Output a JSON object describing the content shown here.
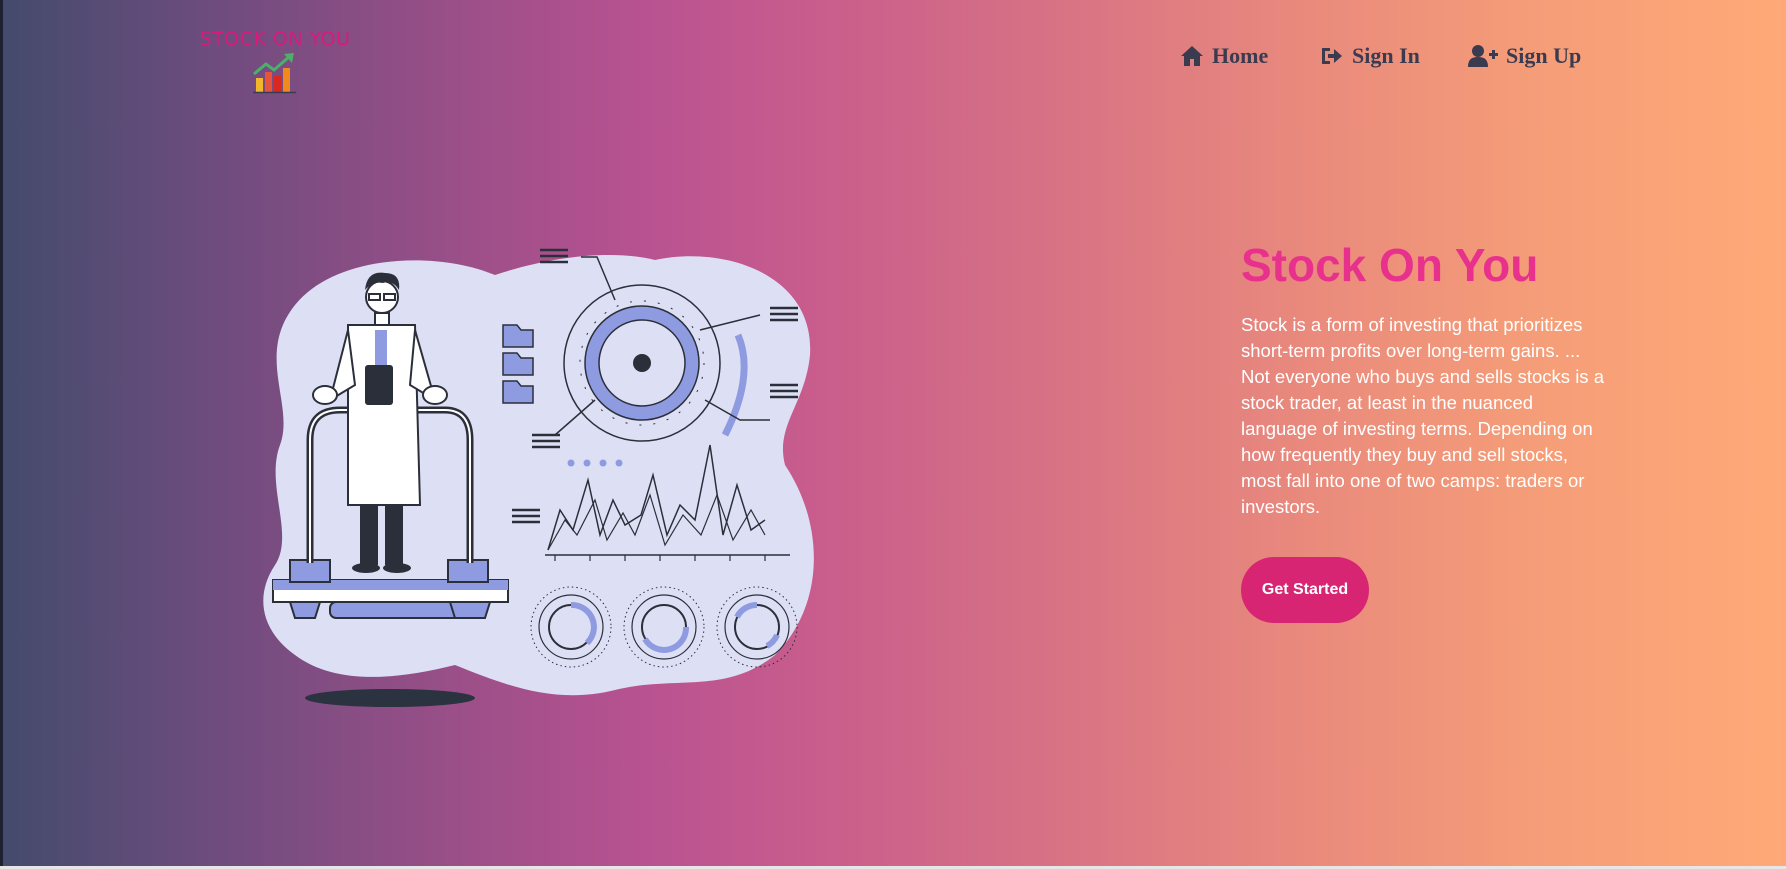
{
  "brand": {
    "logo_text": "STOCK ON YOU",
    "logo_icon": "bar-chart-rising-arrow-icon",
    "accent_color": "#d81b7a"
  },
  "nav": {
    "items": [
      {
        "label": "Home",
        "icon": "home-icon"
      },
      {
        "label": "Sign In",
        "icon": "sign-in-icon"
      },
      {
        "label": "Sign Up",
        "icon": "user-plus-icon"
      }
    ]
  },
  "hero": {
    "title": "Stock On You",
    "title_color": "#e8318c",
    "description": "Stock is a form of investing that prioritizes short-term profits over long-term gains. ... Not everyone who buys and sells stocks is a stock trader, at least in the nuanced language of investing terms. Depending on how frequently they buy and sell stocks, most fall into one of two camps: traders or investors.",
    "cta_label": "Get Started",
    "cta_color": "#d72573"
  },
  "illustration": {
    "subject": "scientist-on-treadmill-analytics-illustration"
  },
  "colors": {
    "gradient_start": "#434b6c",
    "gradient_mid": "#b85291",
    "gradient_end": "#ffa978"
  }
}
